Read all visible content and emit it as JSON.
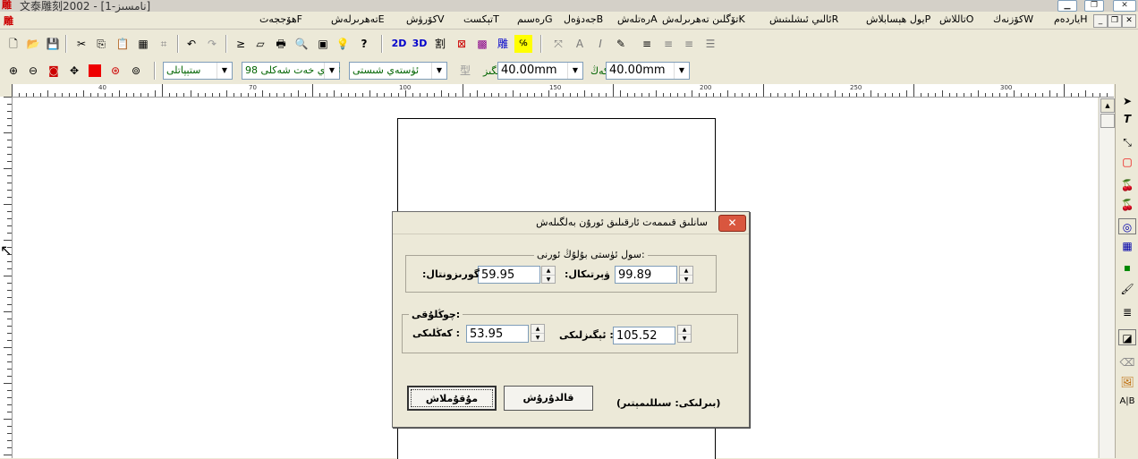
{
  "app": {
    "logo": "雕",
    "title": "文泰雕刻2002 - [نامسىز-1]"
  },
  "menu": [
    "ياردەمH",
    "كۆزنەكW",
    "تاللاشO",
    "يول ھېسابلاشP",
    "ئالىي ئىشلىتىشR",
    "تۆگلىن تەھرىرلەشK",
    "رەتلەشA",
    "جەدۋەلB",
    "رەسىمG",
    "تېكستT",
    "كۆرۈشV",
    "تەھرىرلەشE",
    "ھۆججەتF"
  ],
  "toolbar1": {
    "left_tools": [
      "new-icon",
      "open-icon",
      "save-icon",
      "cut-icon",
      "copy-icon",
      "paste-icon",
      "clipboard-icon",
      "format-icon",
      "undo-icon",
      "redo-icon",
      "send-icon",
      "page-icon",
      "print-icon",
      "preview-icon",
      "properties-icon",
      "bulb-icon",
      "help-icon"
    ],
    "mode_2d": "2D",
    "mode_3d": "3D",
    "mid_tools": [
      "engrave-icon",
      "mirror-icon",
      "color-icon",
      "carve-icon",
      "node-icon"
    ],
    "right_tools": [
      "transform-icon",
      "font-a-icon",
      "italic-icon",
      "edit-text-icon",
      "align-left-icon",
      "align-center-icon",
      "align-right-icon",
      "align-justify-icon"
    ]
  },
  "toolbar2": {
    "zoom_tools": [
      "zoom-in-icon",
      "zoom-out-icon",
      "zoom-fit-icon",
      "pan-icon",
      "red-square-icon",
      "zoom-page-icon",
      "zoom-all-icon"
    ],
    "combo1": "ستېپاتلى",
    "combo2": "98 ئادەي خەت شەكلى",
    "combo3": "ئۈستەي شىستى",
    "height_label": "ئېگىز",
    "height_value": "40.00mm",
    "width_label": "كەڭ",
    "width_value": "40.00mm"
  },
  "dialog": {
    "title": "سانلىق قىممەت ئارقىلىق ئورۇن بەلگىلەش",
    "close": "✕",
    "group_position": "سول ئۈستى بۇلۇڭ ئورنى:",
    "vertical_label": ":ۋېرتىكال",
    "vertical_value": "99.89",
    "horizontal_label": ":گورىزونتال",
    "horizontal_value": "59.95",
    "group_size": "چوڭلۇقى:",
    "height_label": "ئېگىزلىكى :",
    "height_value": "105.52",
    "width_label": "كەڭلىكى :",
    "width_value": "53.95",
    "ok": "مۇقۇملاش",
    "cancel": "قالدۇرۇش",
    "unit": "(بىرلىكى: سىللىمېتىر)"
  },
  "ruler_numbers": [
    "40",
    "70",
    "100",
    "150",
    "200",
    "250",
    "300"
  ]
}
